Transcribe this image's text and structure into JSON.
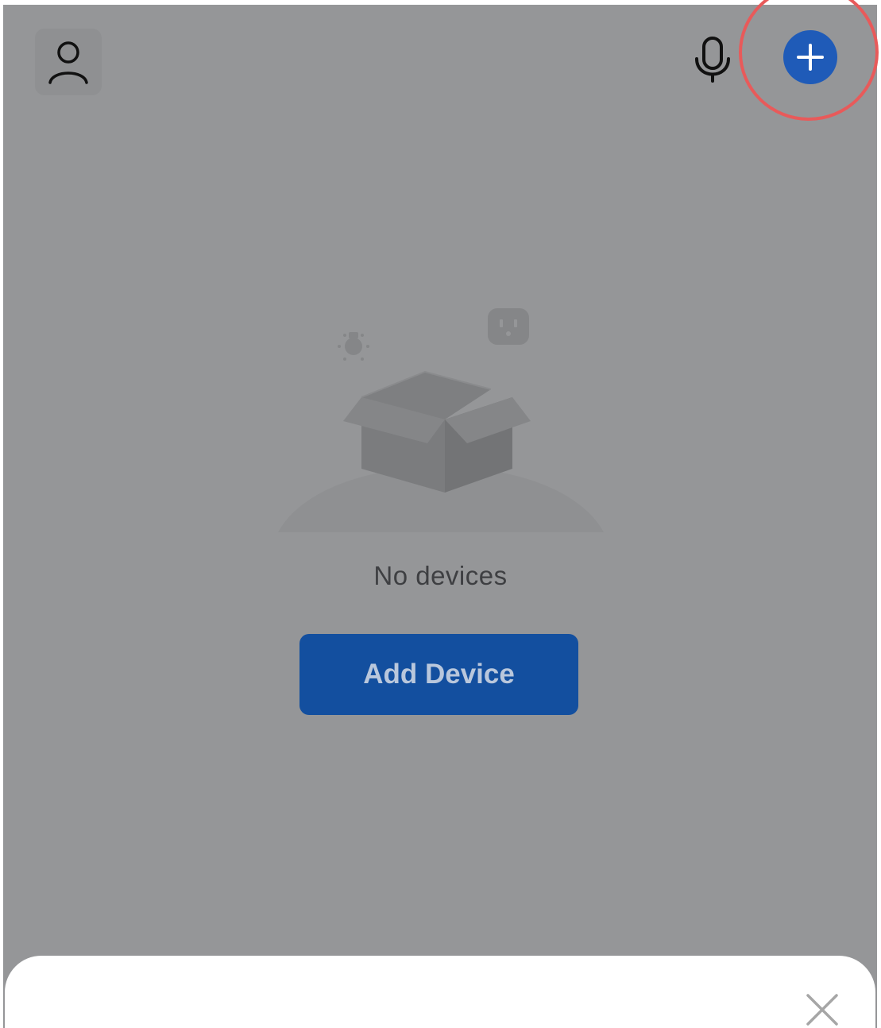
{
  "colors": {
    "overlay_background": "#959698",
    "accent_blue": "#134f9f",
    "plus_button_blue": "#1f5bb8",
    "highlight_ring": "#e85a5a",
    "sheet_background": "#ffffff"
  },
  "top_bar": {
    "profile_icon": "person-outline-icon",
    "mic_icon": "microphone-icon",
    "add_icon": "plus-circle-icon"
  },
  "empty_state": {
    "illustration_icon": "empty-box-icon",
    "message": "No devices"
  },
  "primary_action": {
    "label": "Add Device"
  },
  "bottom_sheet": {
    "close_icon": "close-x-icon"
  }
}
